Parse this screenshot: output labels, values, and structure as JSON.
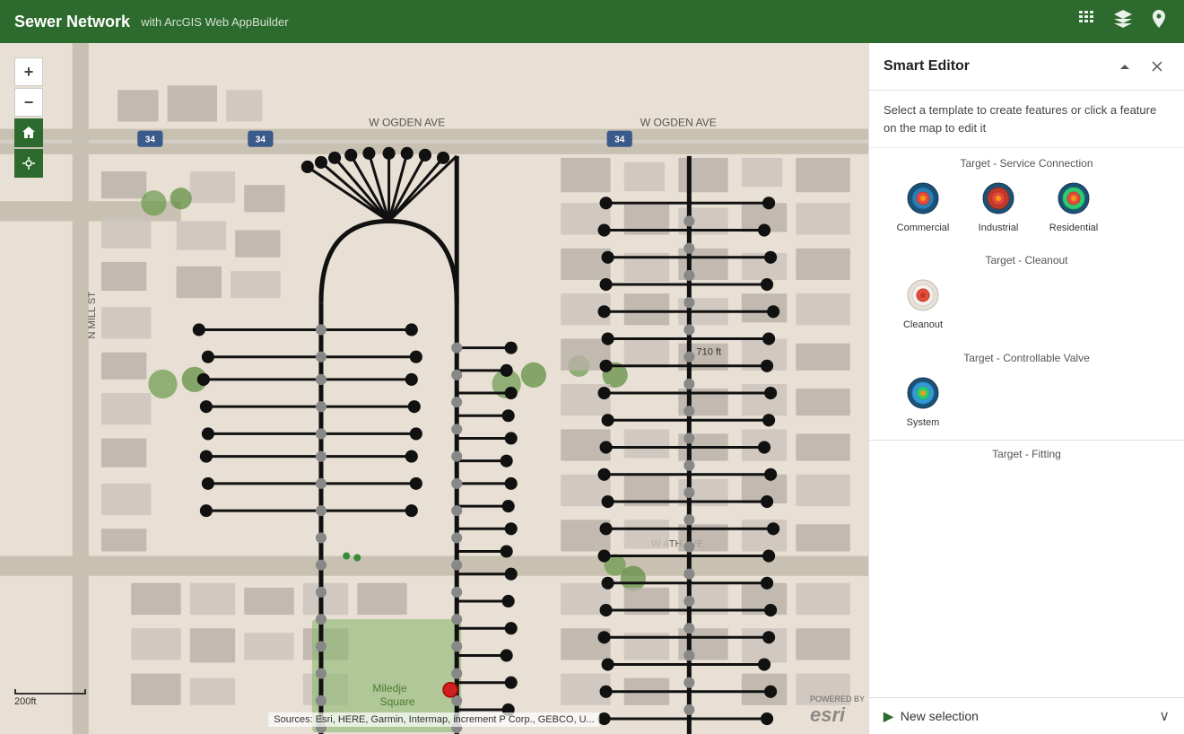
{
  "topbar": {
    "title": "Sewer Network",
    "subtitle": "with ArcGIS Web AppBuilder"
  },
  "smartEditor": {
    "title": "Smart Editor",
    "description": "Select a template to create features or click a feature on the map to edit it",
    "sections": [
      {
        "id": "service-connection",
        "title": "Target - Service Connection",
        "items": [
          {
            "id": "commercial",
            "label": "Commercial",
            "type": "service-connection-commercial"
          },
          {
            "id": "industrial",
            "label": "Industrial",
            "type": "service-connection-industrial"
          },
          {
            "id": "residential",
            "label": "Residential",
            "type": "service-connection-residential"
          }
        ]
      },
      {
        "id": "cleanout",
        "title": "Target - Cleanout",
        "items": [
          {
            "id": "cleanout",
            "label": "Cleanout",
            "type": "cleanout"
          }
        ]
      },
      {
        "id": "controllable-valve",
        "title": "Target - Controllable Valve",
        "items": [
          {
            "id": "system",
            "label": "System",
            "type": "controllable-valve"
          }
        ]
      },
      {
        "id": "fitting",
        "title": "Target - Fitting",
        "items": []
      }
    ],
    "newSelection": "New selection",
    "collapseIcon": "▲",
    "closeIcon": "✕"
  },
  "map": {
    "attribution": "Sources: Esri, HERE, Garmin, Intermap, increment P Corp., GEBCO, U...",
    "distanceLabel": "710 ft",
    "scaleLabel": "200ft"
  }
}
